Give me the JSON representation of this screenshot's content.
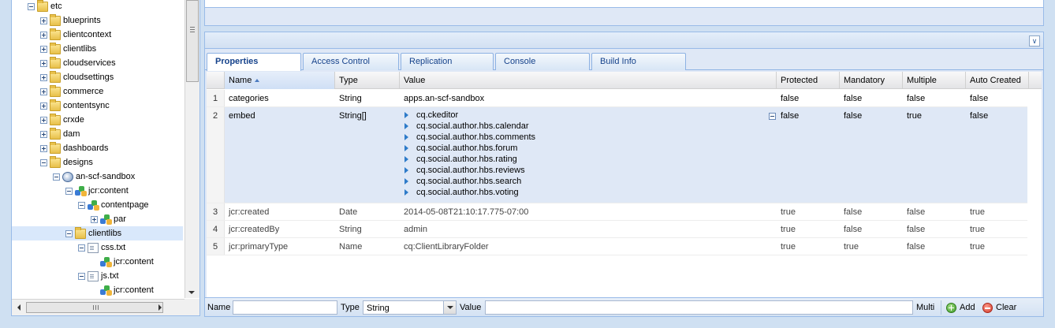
{
  "tree": {
    "nodes": [
      {
        "label": "etc",
        "toggle": "minus",
        "icon": "folder",
        "depth": 0
      },
      {
        "label": "blueprints",
        "toggle": "plus",
        "icon": "folder",
        "depth": 1
      },
      {
        "label": "clientcontext",
        "toggle": "plus",
        "icon": "folder",
        "depth": 1
      },
      {
        "label": "clientlibs",
        "toggle": "plus",
        "icon": "folder",
        "depth": 1
      },
      {
        "label": "cloudservices",
        "toggle": "plus",
        "icon": "folder",
        "depth": 1
      },
      {
        "label": "cloudsettings",
        "toggle": "plus",
        "icon": "folder",
        "depth": 1
      },
      {
        "label": "commerce",
        "toggle": "plus",
        "icon": "folder",
        "depth": 1
      },
      {
        "label": "contentsync",
        "toggle": "plus",
        "icon": "folder",
        "depth": 1
      },
      {
        "label": "crxde",
        "toggle": "plus",
        "icon": "folder",
        "depth": 1
      },
      {
        "label": "dam",
        "toggle": "plus",
        "icon": "folder",
        "depth": 1
      },
      {
        "label": "dashboards",
        "toggle": "plus",
        "icon": "folder",
        "depth": 1
      },
      {
        "label": "designs",
        "toggle": "minus",
        "icon": "folder",
        "depth": 1
      },
      {
        "label": "an-scf-sandbox",
        "toggle": "minus",
        "icon": "site",
        "depth": 2
      },
      {
        "label": "jcr:content",
        "toggle": "minus",
        "icon": "node",
        "depth": 3
      },
      {
        "label": "contentpage",
        "toggle": "minus",
        "icon": "node",
        "depth": 4
      },
      {
        "label": "par",
        "toggle": "plus",
        "icon": "node",
        "depth": 5
      },
      {
        "label": "clientlibs",
        "toggle": "minus",
        "icon": "folder",
        "depth": 3,
        "selected": true
      },
      {
        "label": "css.txt",
        "toggle": "minus",
        "icon": "file",
        "depth": 4
      },
      {
        "label": "jcr:content",
        "toggle": "none",
        "icon": "node",
        "depth": 5
      },
      {
        "label": "js.txt",
        "toggle": "minus",
        "icon": "file",
        "depth": 4
      },
      {
        "label": "jcr:content",
        "toggle": "none",
        "icon": "node",
        "depth": 5
      }
    ]
  },
  "tabs": [
    {
      "label": "Properties",
      "active": true
    },
    {
      "label": "Access Control",
      "active": false
    },
    {
      "label": "Replication",
      "active": false
    },
    {
      "label": "Console",
      "active": false
    },
    {
      "label": "Build Info",
      "active": false
    }
  ],
  "grid": {
    "columns": [
      "Name",
      "Type",
      "Value",
      "Protected",
      "Mandatory",
      "Multiple",
      "Auto Created"
    ],
    "sorted_column": "Name",
    "rows": [
      {
        "num": "1",
        "name": "categories",
        "type": "String",
        "values": [
          "apps.an-scf-sandbox"
        ],
        "protected": "false",
        "mandatory": "false",
        "multiple": "false",
        "auto_created": "false",
        "selected": false,
        "grey": false
      },
      {
        "num": "2",
        "name": "embed",
        "type": "String[]",
        "values": [
          "cq.ckeditor",
          "cq.social.author.hbs.calendar",
          "cq.social.author.hbs.comments",
          "cq.social.author.hbs.forum",
          "cq.social.author.hbs.rating",
          "cq.social.author.hbs.reviews",
          "cq.social.author.hbs.search",
          "cq.social.author.hbs.voting"
        ],
        "multi": true,
        "protected": "false",
        "mandatory": "false",
        "multiple": "true",
        "auto_created": "false",
        "selected": true,
        "grey": false
      },
      {
        "num": "3",
        "name": "jcr:created",
        "type": "Date",
        "values": [
          "2014-05-08T21:10:17.775-07:00"
        ],
        "protected": "true",
        "mandatory": "false",
        "multiple": "false",
        "auto_created": "true",
        "selected": false,
        "grey": true
      },
      {
        "num": "4",
        "name": "jcr:createdBy",
        "type": "String",
        "values": [
          "admin"
        ],
        "protected": "true",
        "mandatory": "false",
        "multiple": "false",
        "auto_created": "true",
        "selected": false,
        "grey": true
      },
      {
        "num": "5",
        "name": "jcr:primaryType",
        "type": "Name",
        "values": [
          "cq:ClientLibraryFolder"
        ],
        "protected": "true",
        "mandatory": "true",
        "multiple": "false",
        "auto_created": "true",
        "selected": false,
        "grey": true
      }
    ]
  },
  "toolbar": {
    "name_label": "Name",
    "name_value": "",
    "type_label": "Type",
    "type_value": "String",
    "value_label": "Value",
    "value_value": "",
    "multi_label": "Multi",
    "add_label": "Add",
    "clear_label": "Clear"
  },
  "icons": {
    "collapse_panel": "double-chevron-down-icon",
    "tree_scroll_h_glyph": "III"
  }
}
